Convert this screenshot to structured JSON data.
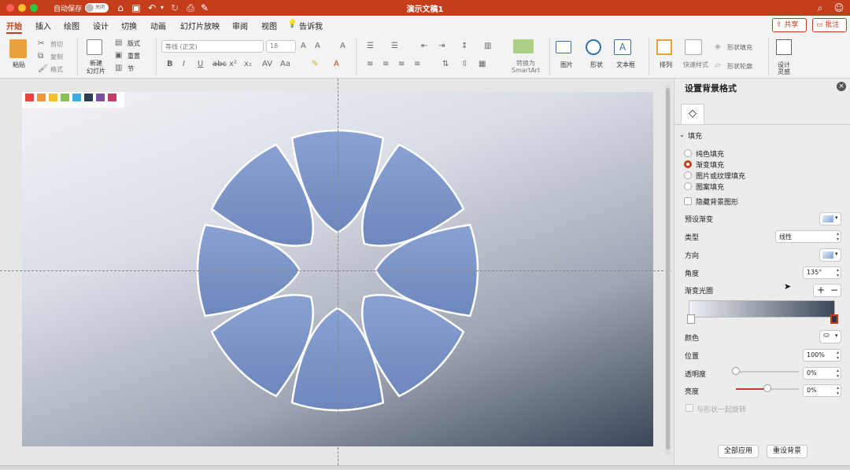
{
  "titlebar": {
    "autosave_label": "自动保存",
    "autosave_toggle": "关闭",
    "doc_title": "演示文稿1"
  },
  "tabs": [
    "开始",
    "插入",
    "绘图",
    "设计",
    "切换",
    "动画",
    "幻灯片放映",
    "审阅",
    "视图"
  ],
  "tell_me": "告诉我",
  "share_label": "共享",
  "comment_label": "批注",
  "ribbon": {
    "paste": "粘贴",
    "cut": "剪切",
    "copy": "复制",
    "format": "格式",
    "new_slide_1": "新建",
    "new_slide_2": "幻灯片",
    "layout": "版式",
    "reset": "重置",
    "section": "节",
    "font_name": "等线 (正文)",
    "font_size": "18",
    "convert_1": "转换为",
    "convert_2": "SmartArt",
    "picture": "图片",
    "shape": "形状",
    "textbox": "文本框",
    "arrange": "排列",
    "quick_styles": "快速样式",
    "shape_fill": "形状填充",
    "shape_outline": "形状轮廓",
    "design_1": "设计",
    "design_2": "灵感"
  },
  "swatches": [
    "#e8453c",
    "#f0953a",
    "#f2c12e",
    "#8cc152",
    "#3aaee0",
    "#2d3e55",
    "#7b4e9e",
    "#c23b6b"
  ],
  "panel": {
    "title": "设置背景格式",
    "section": "填充",
    "fill_options": [
      {
        "label": "纯色填充",
        "selected": false
      },
      {
        "label": "渐变填充",
        "selected": true
      },
      {
        "label": "图片或纹理填充",
        "selected": false
      },
      {
        "label": "图案填充",
        "selected": false
      }
    ],
    "hide_bg": "隐藏背景图形",
    "preset_label": "预设渐变",
    "type_label": "类型",
    "type_value": "线性",
    "direction_label": "方向",
    "angle_label": "角度",
    "angle_value": "135°",
    "stops_label": "渐变光圈",
    "color_label": "颜色",
    "position_label": "位置",
    "position_value": "100%",
    "transparency_label": "透明度",
    "transparency_value": "0%",
    "brightness_label": "亮度",
    "brightness_value": "0%",
    "rotate_with_shape": "与形状一起旋转",
    "apply_all": "全部应用",
    "reset_bg": "重设背景"
  },
  "colors": {
    "accent": "#c43e1c",
    "petal": "#7d96c8",
    "grad_start": "#f2f3f7",
    "grad_end": "#3b4658"
  }
}
